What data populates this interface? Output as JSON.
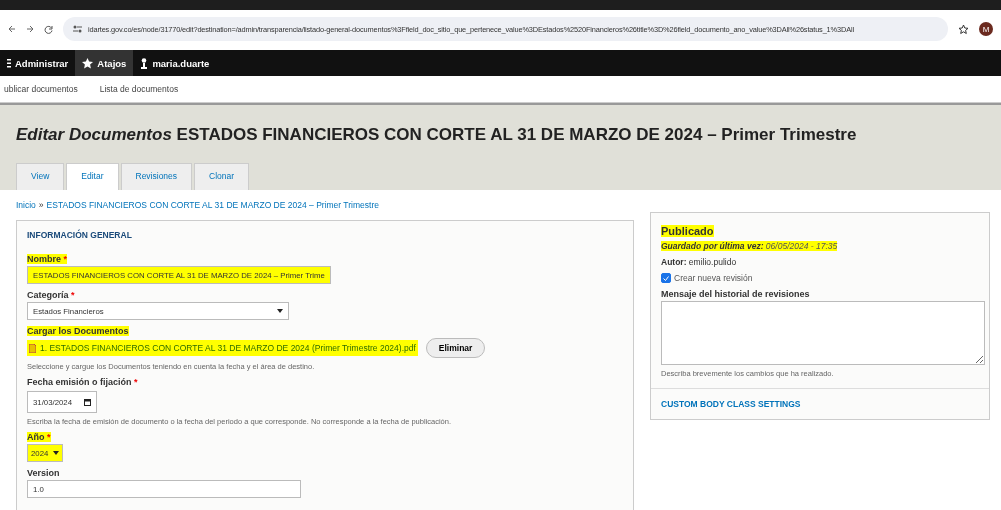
{
  "browser": {
    "url": "idartes.gov.co/es/node/31770/edit?destination=/admin/transparencia/listado-general-documentos%3Ffield_doc_sitio_que_pertenece_value%3DEstados%2520Financieros%26title%3D%26field_documento_ano_value%3DAll%26status_1%3DAll",
    "avatar": "M"
  },
  "admin_toolbar": [
    {
      "label": "Administrar",
      "kind": "menu"
    },
    {
      "label": "Atajos",
      "kind": "star",
      "selected": true
    },
    {
      "label": "maria.duarte",
      "kind": "user",
      "selected": false
    }
  ],
  "shortcuts": [
    "ublicar documentos",
    "Lista de documentos"
  ],
  "header": {
    "title_prefix": "Editar Documentos",
    "title": "ESTADOS FINANCIEROS CON CORTE AL 31 DE MARZO DE 2024 – Primer Trimestre"
  },
  "tabs": [
    {
      "label": "View",
      "selected": false
    },
    {
      "label": "Editar",
      "selected": true
    },
    {
      "label": "Revisiones",
      "selected": false
    },
    {
      "label": "Clonar",
      "selected": false
    }
  ],
  "breadcrumb": {
    "separator": "»",
    "items": [
      "Inicio",
      "ESTADOS FINANCIEROS CON CORTE AL 31 DE MARZO DE 2024 – Primer Trimestre"
    ]
  },
  "form": {
    "section_title": "INFORMACIÓN GENERAL",
    "fields": [
      {
        "kind": "text",
        "label": "Nombre",
        "required_mark": "*",
        "value": "ESTADOS FINANCIEROS CON CORTE AL 31 DE MARZO DE 2024 – Primer Trime",
        "highlighted": true
      },
      {
        "kind": "select",
        "label": "Categoría",
        "required_mark": "*",
        "value": "Estados Financieros",
        "highlighted": false
      },
      {
        "kind": "file",
        "label": "Cargar los Documentos",
        "file": "1. ESTADOS FINANCIEROS CON CORTE AL 31 DE MARZO DE 2024 (Primer Trimestre 2024).pdf",
        "button": "Eliminar",
        "description": "Seleccione y cargue los Documentos teniendo en cuenta la fecha y el área de destino.",
        "highlighted": true
      },
      {
        "kind": "date",
        "label": "Fecha emisión o fijación",
        "required_mark": "*",
        "value": "31/03/2024",
        "description": "Escriba la fecha de emisión de documento o la fecha del periodo a que corresponde. No corresponde a la fecha de publicación.",
        "highlighted": false
      },
      {
        "kind": "small-select",
        "label": "Año",
        "required_mark": "*",
        "value": "2024",
        "highlighted": true
      },
      {
        "kind": "text",
        "label": "Version",
        "value": "1.0",
        "highlighted": false
      }
    ]
  },
  "sidebar": {
    "status": "Publicado",
    "saved_label": "Guardado por última vez:",
    "saved_value": "06/05/2024 - 17:35",
    "highlighted": true,
    "author_label": "Autor:",
    "author": "emilio.pulido",
    "new_revision": {
      "label": "Crear nueva revisión",
      "checked": true
    },
    "log_label": "Mensaje del historial de revisiones",
    "log_description": "Describa brevemente los cambios que ha realizado.",
    "section_link": "CUSTOM BODY CLASS SETTINGS"
  }
}
